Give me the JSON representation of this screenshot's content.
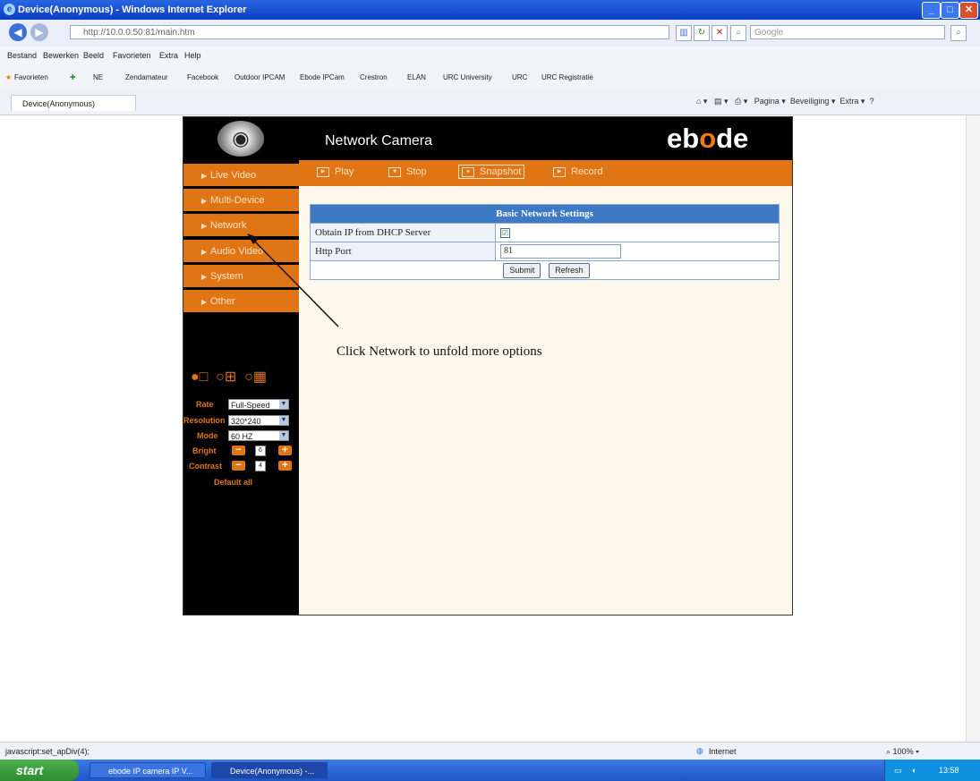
{
  "window": {
    "title": "Device(Anonymous) - Windows Internet Explorer"
  },
  "address": {
    "url": "http://10.0.0.50:81/main.htm",
    "search_placeholder": "Google"
  },
  "menu": [
    "Bestand",
    "Bewerken",
    "Beeld",
    "Favorieten",
    "Extra",
    "Help"
  ],
  "favorites": {
    "label": "Favorieten",
    "items": [
      "NE",
      "Zendamateur",
      "Facebook",
      "Outdoor IPCAM",
      "Ebode IPCam",
      "Crestron",
      "ELAN",
      "URC University",
      "URC",
      "URC Registratie"
    ]
  },
  "tab": {
    "label": "Device(Anonymous)"
  },
  "toolbar_right": {
    "page": "Pagina",
    "safety": "Beveiliging",
    "extra": "Extra"
  },
  "camera": {
    "title": "Network Camera",
    "brand_left": "eb",
    "brand_o": "o",
    "brand_right": "de",
    "sidebar": [
      "Live Video",
      "Multi-Device",
      "Network",
      "Audio Video",
      "System",
      "Other"
    ],
    "actions": [
      "Play",
      "Stop",
      "Snapshot",
      "Record"
    ],
    "controls": {
      "rate_label": "Rate",
      "rate_value": "Full-Speed",
      "resolution_label": "Resolution",
      "resolution_value": "320*240",
      "mode_label": "Mode",
      "mode_value": "60 HZ",
      "bright_label": "Bright",
      "bright_value": "6",
      "contrast_label": "Contrast",
      "contrast_value": "4",
      "default_all": "Default all"
    }
  },
  "network_settings": {
    "header": "Basic Network Settings",
    "dhcp_label": "Obtain IP from DHCP Server",
    "dhcp_checked": "☑",
    "http_port_label": "Http Port",
    "http_port_value": "81",
    "submit": "Submit",
    "refresh": "Refresh"
  },
  "callout": "Click Network to unfold more options",
  "status": {
    "left": "javascript:set_apDiv(4);",
    "zone": "Internet",
    "zoom": "100%"
  },
  "taskbar": {
    "start": "start",
    "tasks": [
      "ebode IP camera IP V...",
      "Device(Anonymous) -..."
    ],
    "clock": "13:58"
  }
}
